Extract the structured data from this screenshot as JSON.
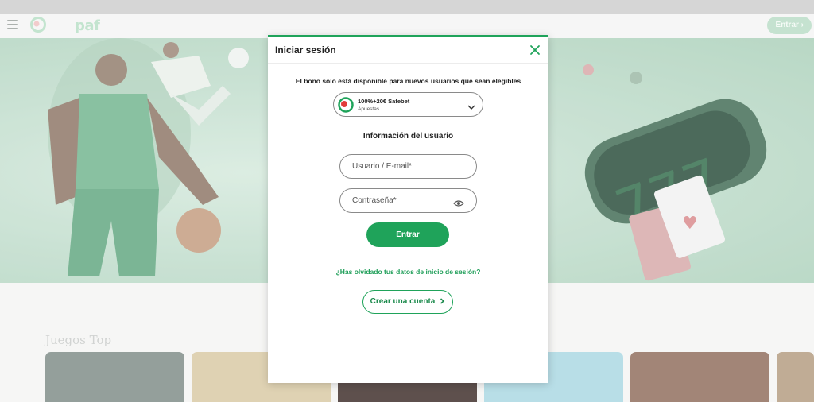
{
  "header": {
    "logo_text": "paf",
    "login_button": "Entrar",
    "menu_icon": "hamburger-menu-icon"
  },
  "below_fold": {
    "section_title": "Juegos Top"
  },
  "modal": {
    "title": "Iniciar sesión",
    "close_icon": "close-icon",
    "bonus_note": "El bono solo está disponible para nuevos usuarios que sean elegibles",
    "bonus": {
      "name": "100%+20€ Safebet",
      "category": "Apuestas",
      "icon": "chevron-down-icon"
    },
    "user_info_title": "Información del usuario",
    "username_placeholder": "Usuario / E-mail*",
    "password_placeholder": "Contraseña*",
    "password_toggle_icon": "eye-icon",
    "submit_label": "Entrar",
    "forgot_link": "¿Has olvidado tus datos de inicio de sesión?",
    "create_account_label": "Crear una cuenta"
  },
  "colors": {
    "brand_green": "#1fa35a",
    "link_green": "#1e9e58",
    "hero_green": "#bfdccb"
  }
}
